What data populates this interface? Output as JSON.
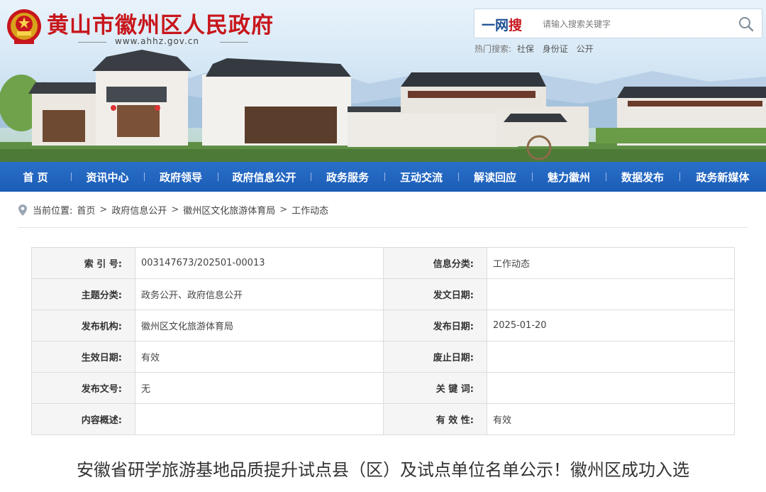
{
  "header": {
    "site_title": "黄山市徽州区人民政府",
    "domain": "www.ahhz.gov.cn",
    "emblem_icon": "national-emblem-icon",
    "brand_red": "#c7161c"
  },
  "search": {
    "logo_part1": "一网",
    "logo_part2": "搜",
    "placeholder": "请输入搜索关键字",
    "button_icon": "search-icon",
    "hot_label": "热门搜索:",
    "hot_terms": [
      "社保",
      "身份证",
      "公开"
    ]
  },
  "nav": {
    "color": "#1b5db7",
    "items": [
      "首 页",
      "资讯中心",
      "政府领导",
      "政府信息公开",
      "政务服务",
      "互动交流",
      "解读回应",
      "魅力徽州",
      "数据发布",
      "政务新媒体"
    ]
  },
  "breadcrumb": {
    "label": "当前位置:",
    "items": [
      "首页",
      "政府信息公开",
      "徽州区文化旅游体育局",
      "工作动态"
    ],
    "separator": ">",
    "icon": "location-pin-icon"
  },
  "info_table": {
    "rows": [
      {
        "k1": "索 引 号:",
        "v1": "003147673/202501-00013",
        "k2": "信息分类:",
        "v2": "工作动态"
      },
      {
        "k1": "主题分类:",
        "v1": "政务公开、政府信息公开",
        "k2": "发文日期:",
        "v2": ""
      },
      {
        "k1": "发布机构:",
        "v1": "徽州区文化旅游体育局",
        "k2": "发布日期:",
        "v2": "2025-01-20"
      },
      {
        "k1": "生效日期:",
        "v1": "有效",
        "k2": "废止日期:",
        "v2": ""
      },
      {
        "k1": "发布文号:",
        "v1": "无",
        "k2": "关 键 词:",
        "v2": ""
      },
      {
        "k1": "内容概述:",
        "v1": "",
        "k2": "有 效 性:",
        "v2": "有效"
      }
    ]
  },
  "article": {
    "title": "安徽省研学旅游基地品质提升试点县（区）及试点单位名单公示！徽州区成功入选"
  }
}
